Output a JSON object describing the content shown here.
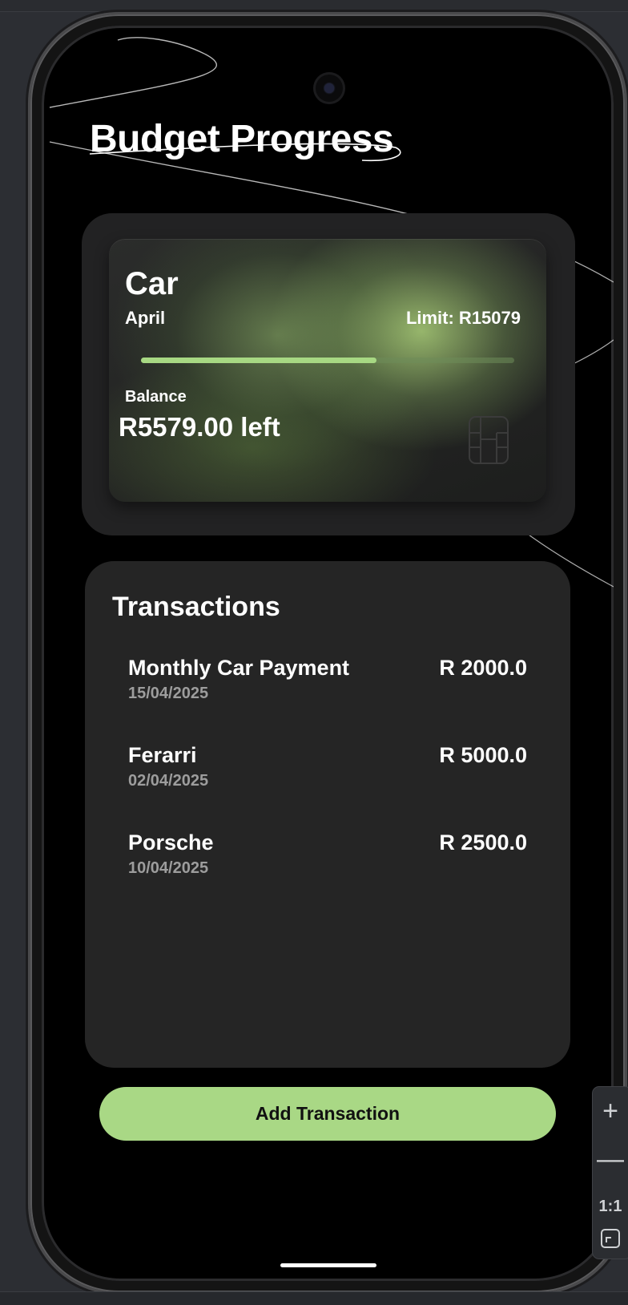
{
  "screen": {
    "title": "Budget Progress"
  },
  "budget_card": {
    "category": "Car",
    "month": "April",
    "limit": "Limit: R15079",
    "progress": 0.63,
    "balance_label": "Balance",
    "balance_value": "R5579.00 left",
    "chip_icon": "card-chip-icon"
  },
  "transactions": {
    "heading": "Transactions",
    "items": [
      {
        "name": "Monthly Car Payment",
        "date": "15/04/2025",
        "amount": "R 2000.0"
      },
      {
        "name": "Ferarri",
        "date": "02/04/2025",
        "amount": "R 5000.0"
      },
      {
        "name": "Porsche",
        "date": "10/04/2025",
        "amount": "R 2500.0"
      }
    ]
  },
  "actions": {
    "add_transaction": "Add Transaction"
  },
  "zoom_controls": {
    "zoom_in": "+",
    "zoom_out": "—",
    "ratio": "1:1",
    "fit_icon": "fit-screen-icon"
  },
  "colors": {
    "background": "#000000",
    "panel": "#252525",
    "accent": "#a9d885",
    "muted_text": "#9d9d9d"
  }
}
